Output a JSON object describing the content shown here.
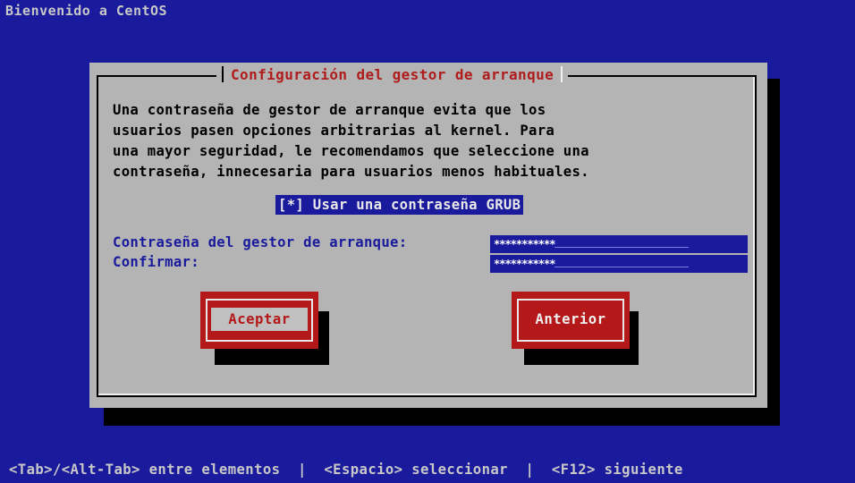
{
  "screen": {
    "title": "Bienvenido a CentOS",
    "background_color": "#1a1a9c"
  },
  "dialog": {
    "title": "Configuración del gestor de arranque",
    "description": "Una contraseña de gestor de arranque evita que los\nusuarios pasen opciones arbitrarias al kernel.  Para\nuna mayor seguridad, le recomendamos que seleccione una\ncontraseña, innecesaria para usuarios menos habituales.",
    "checkbox": {
      "label": "[*] Usar una contraseña GRUB",
      "checked": true
    },
    "fields": [
      {
        "label": "Contraseña del gestor de arranque:",
        "value_masked": "***********"
      },
      {
        "label": "Confirmar:",
        "value_masked": "***********"
      }
    ],
    "buttons": {
      "ok_label": "Aceptar",
      "back_label": "Anterior"
    }
  },
  "help_bar": "<Tab>/<Alt-Tab> entre elementos  |  <Espacio> seleccionar  |  <F12> siguiente",
  "colors": {
    "dialog_bg": "#b4b4b4",
    "title_color": "#b01c1c",
    "button_color": "#b41818",
    "field_bg": "#1a1a9c"
  }
}
